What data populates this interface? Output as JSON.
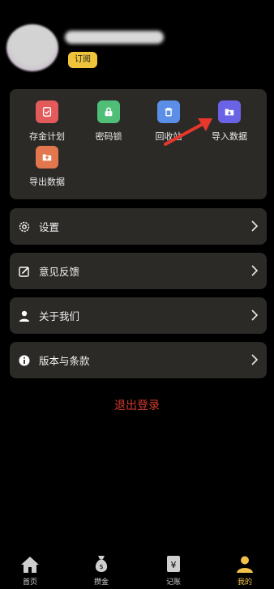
{
  "profile": {
    "subscribe_label": "订阅"
  },
  "grid": {
    "items": [
      {
        "label": "存金计划",
        "icon": "savings-plan-icon",
        "color": "#e25a5a"
      },
      {
        "label": "密码锁",
        "icon": "lock-icon",
        "color": "#4fbf78"
      },
      {
        "label": "回收站",
        "icon": "trash-icon",
        "color": "#5b8ee6"
      },
      {
        "label": "导入数据",
        "icon": "import-folder-icon",
        "color": "#6b63e6"
      },
      {
        "label": "导出数据",
        "icon": "export-folder-icon",
        "color": "#e2774d"
      }
    ]
  },
  "menu": {
    "items": [
      {
        "label": "设置",
        "icon": "gear-icon"
      },
      {
        "label": "意见反馈",
        "icon": "feedback-icon"
      },
      {
        "label": "关于我们",
        "icon": "user-icon"
      },
      {
        "label": "版本与条款",
        "icon": "info-icon"
      }
    ]
  },
  "logout_label": "退出登录",
  "tabs": [
    {
      "label": "首页",
      "icon": "home-icon"
    },
    {
      "label": "攒金",
      "icon": "money-bag-icon"
    },
    {
      "label": "记账",
      "icon": "ledger-icon"
    },
    {
      "label": "我的",
      "icon": "profile-icon",
      "active": true
    }
  ],
  "colors": {
    "accent": "#f2c14b",
    "danger": "#d23a2c",
    "card": "#2b2a27"
  }
}
